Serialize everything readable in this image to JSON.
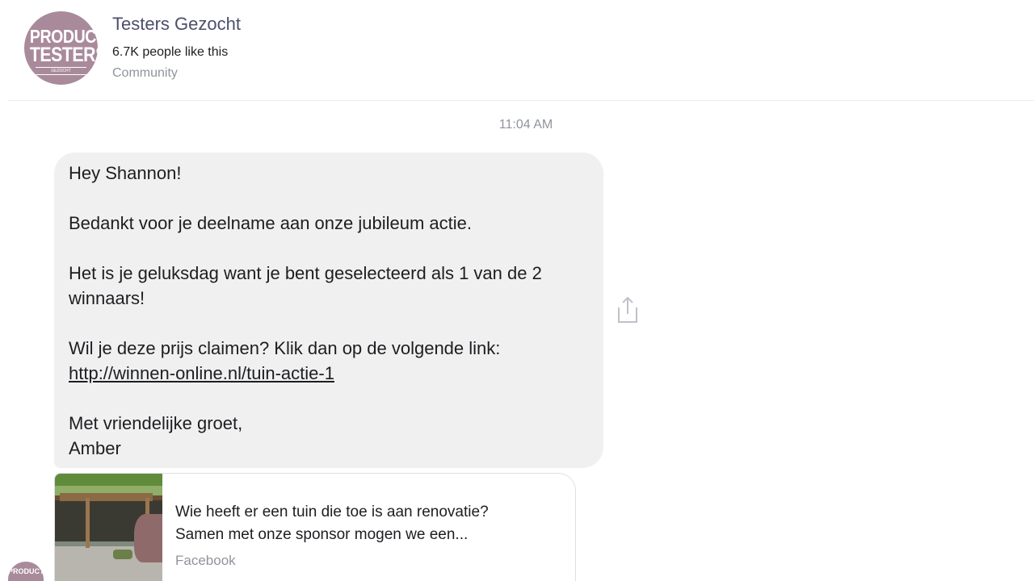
{
  "header": {
    "avatar_line1": "PRODUCT",
    "avatar_line2": "TESTERS",
    "avatar_tag": "GEZOCHT",
    "page_name": "Testers Gezocht",
    "likes": "6.7K people like this",
    "category": "Community"
  },
  "conversation": {
    "timestamp": "11:04 AM",
    "message": {
      "greeting": "Hey Shannon!",
      "line_thanks": "Bedankt voor je deelname aan onze jubileum actie.",
      "line_winner_1": "Het is je geluksdag want je bent geselecteerd als 1 van de 2",
      "line_winner_2": "winnaars!",
      "line_claim": "Wil je deze prijs claimen? Klik dan op de volgende link:",
      "link": "http://winnen-online.nl/tuin-actie-1",
      "closing": "Met vriendelijke groet,",
      "signature": "Amber"
    },
    "preview": {
      "title_line1": "Wie heeft er een tuin die toe is aan renovatie?",
      "title_line2": "Samen met onze sponsor mogen we een...",
      "source": "Facebook"
    },
    "sender_avatar": "PRODUCT"
  },
  "icons": {
    "share": "share-icon"
  },
  "colors": {
    "bubble": "#f1f0f0",
    "avatar": "#a98a9a",
    "secondary_text": "#90949c",
    "page_name": "#4b4f6b"
  }
}
